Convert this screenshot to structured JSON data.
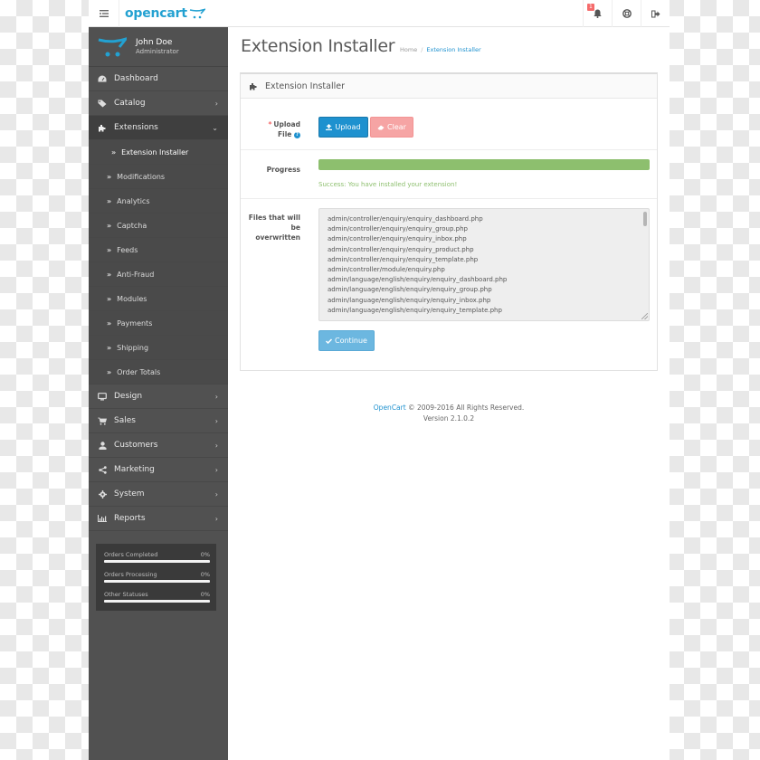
{
  "header": {
    "logo_text": "opencart",
    "notification_count": "1"
  },
  "user": {
    "name": "John Doe",
    "role": "Administrator"
  },
  "sidebar": {
    "items": [
      {
        "label": "Dashboard",
        "icon": "dashboard-icon",
        "has_children": false
      },
      {
        "label": "Catalog",
        "icon": "tags-icon",
        "has_children": true
      },
      {
        "label": "Extensions",
        "icon": "puzzle-icon",
        "has_children": true,
        "expanded": true
      },
      {
        "label": "Design",
        "icon": "monitor-icon",
        "has_children": true
      },
      {
        "label": "Sales",
        "icon": "cart-icon",
        "has_children": true
      },
      {
        "label": "Customers",
        "icon": "user-icon",
        "has_children": true
      },
      {
        "label": "Marketing",
        "icon": "share-icon",
        "has_children": true
      },
      {
        "label": "System",
        "icon": "gear-icon",
        "has_children": true
      },
      {
        "label": "Reports",
        "icon": "bar-chart-icon",
        "has_children": true
      }
    ],
    "extensions_children": [
      {
        "label": "Extension Installer",
        "active": true
      },
      {
        "label": "Modifications"
      },
      {
        "label": "Analytics"
      },
      {
        "label": "Captcha"
      },
      {
        "label": "Feeds"
      },
      {
        "label": "Anti-Fraud"
      },
      {
        "label": "Modules"
      },
      {
        "label": "Payments"
      },
      {
        "label": "Shipping"
      },
      {
        "label": "Order Totals"
      }
    ],
    "stats": [
      {
        "label": "Orders Completed",
        "value": "0%",
        "percent": 0
      },
      {
        "label": "Orders Processing",
        "value": "0%",
        "percent": 0
      },
      {
        "label": "Other Statuses",
        "value": "0%",
        "percent": 0
      }
    ]
  },
  "main": {
    "title": "Extension Installer",
    "breadcrumb": [
      "Home",
      "Extension Installer"
    ],
    "panel_title": "Extension Installer",
    "upload_label_1": "Upload",
    "upload_label_2": "File",
    "upload_button": "Upload",
    "clear_button": "Clear",
    "progress_label": "Progress",
    "progress_percent": 100,
    "success_message": "Success: You have installed your extension!",
    "files_label_1": "Files that will",
    "files_label_2": "be",
    "files_label_3": "overwritten",
    "files": [
      "admin/controller/enquiry/enquiry_dashboard.php",
      "admin/controller/enquiry/enquiry_group.php",
      "admin/controller/enquiry/enquiry_inbox.php",
      "admin/controller/enquiry/enquiry_product.php",
      "admin/controller/enquiry/enquiry_template.php",
      "admin/controller/module/enquiry.php",
      "admin/language/english/enquiry/enquiry_dashboard.php",
      "admin/language/english/enquiry/enquiry_group.php",
      "admin/language/english/enquiry/enquiry_inbox.php",
      "admin/language/english/enquiry/enquiry_template.php"
    ],
    "continue_button": "Continue"
  },
  "footer": {
    "link": "OpenCart",
    "copyright": " © 2009-2016 All Rights Reserved.",
    "version": "Version 2.1.0.2"
  },
  "colors": {
    "brand": "#23a1d1",
    "primary": "#1e91cf",
    "danger": "#f6a4a4",
    "success": "#8dbf6e",
    "sidebar_bg": "#515151"
  }
}
